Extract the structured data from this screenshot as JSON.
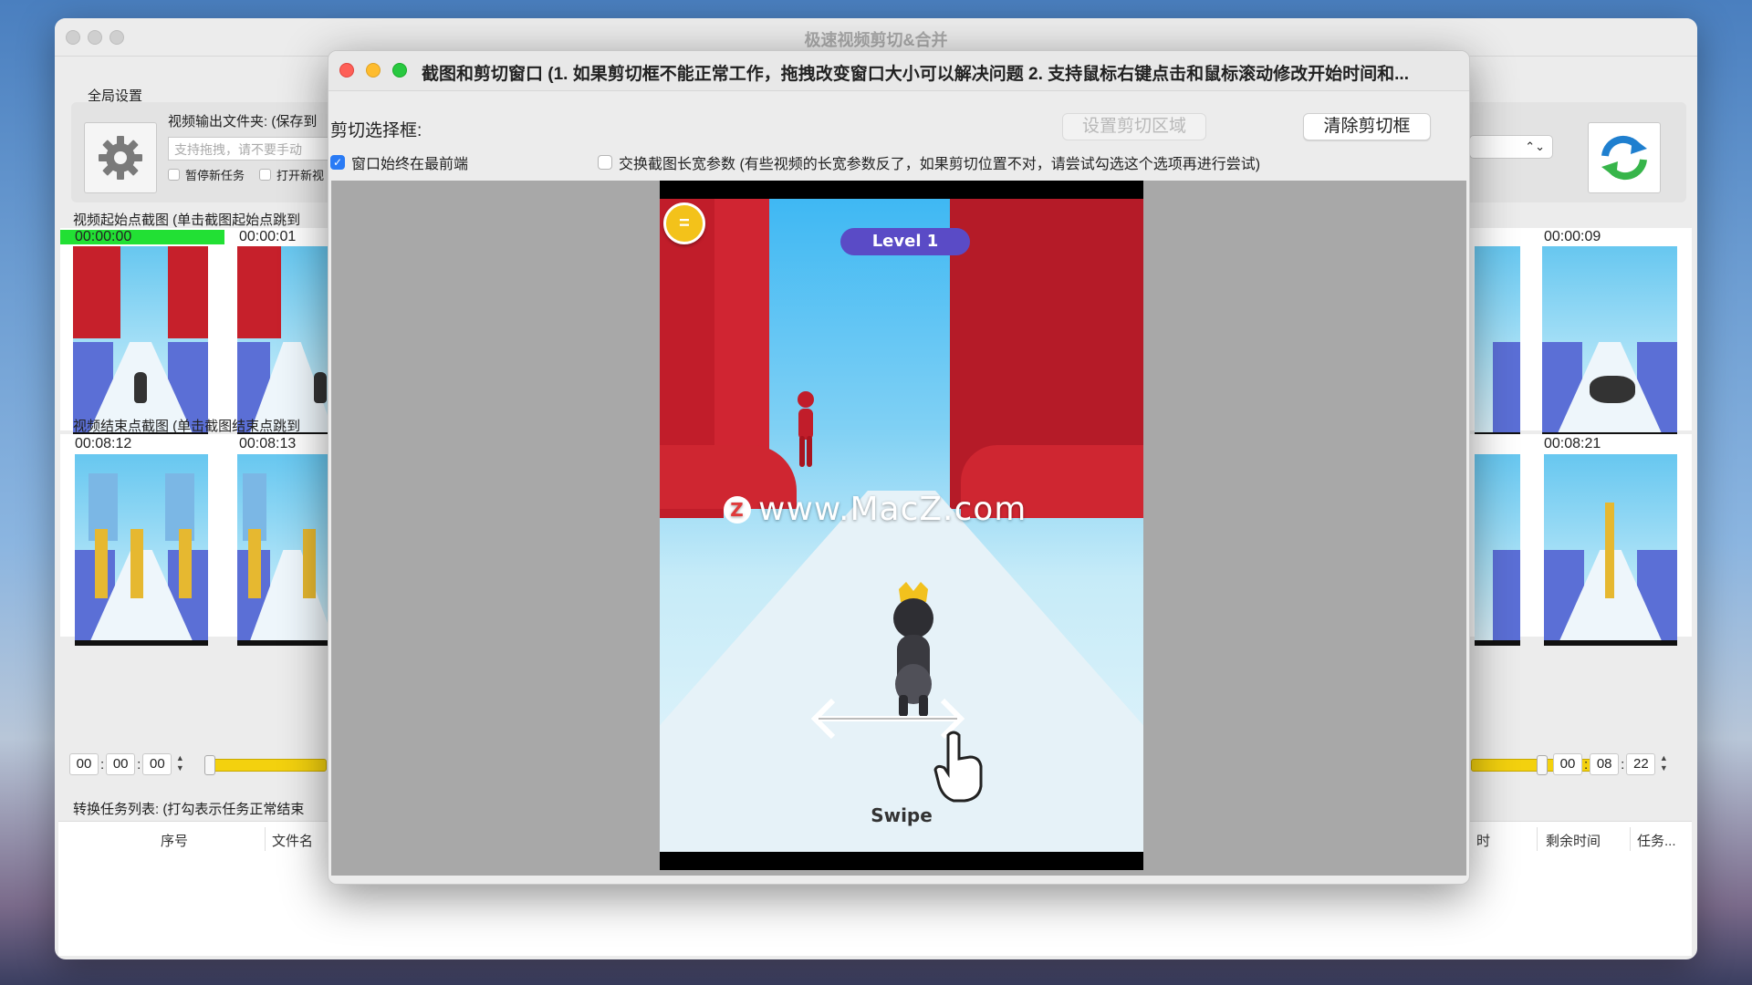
{
  "main": {
    "title": "极速视频剪切&合并",
    "global_settings_label": "全局设置",
    "output_folder_label": "视频输出文件夹: (保存到",
    "folder_placeholder": "支持拖拽，请不要手动",
    "pause_new_tasks": "暂停新任务",
    "open_new": "打开新视",
    "right_select_value": "",
    "start_frames_label": "视频起始点截图 (单击截图起始点跳到",
    "end_frames_label": "视频结束点截图 (单击截图结束点跳到",
    "start_thumbs": [
      {
        "time": "00:00:00",
        "highlight": true
      },
      {
        "time": "00:00:01",
        "highlight": false
      },
      {
        "time": "00:00:09",
        "highlight": false
      }
    ],
    "end_thumbs": [
      {
        "time": "00:08:12"
      },
      {
        "time": "00:08:13"
      },
      {
        "time": "00:08:21"
      }
    ],
    "start_time": {
      "h": "00",
      "m": "00",
      "s": "00"
    },
    "end_time": {
      "h": "00",
      "m": "08",
      "s": "22"
    },
    "task_list_label": "转换任务列表: (打勾表示任务正常结束",
    "columns": [
      "序号",
      "文件名",
      "时",
      "剩余时间",
      "任务..."
    ]
  },
  "crop_window": {
    "title": "截图和剪切窗口 (1. 如果剪切框不能正常工作，拖拽改变窗口大小可以解决问题 2. 支持鼠标右键点击和鼠标滚动修改开始时间和...",
    "crop_select_label": "剪切选择框:",
    "set_crop_button": "设置剪切区域",
    "clear_crop_button": "清除剪切框",
    "always_on_top_label": "窗口始终在最前端",
    "always_on_top_checked": true,
    "swap_label": "交换截图长宽参数 (有些视频的长宽参数反了，如果剪切位置不对，请尝试勾选这个选项再进行尝试)",
    "swap_checked": false
  },
  "preview": {
    "level_text": "Level 1",
    "swipe_text": "Swipe",
    "watermark": "www.MacZ.com",
    "watermark_logo": "Z"
  },
  "colors": {
    "highlight_green": "#22e034",
    "slider_yellow": "#f3d10e",
    "checkbox_blue": "#2a7bf5",
    "wall_red": "#c11d2a",
    "road_edge_blue": "#5b6bd8"
  }
}
